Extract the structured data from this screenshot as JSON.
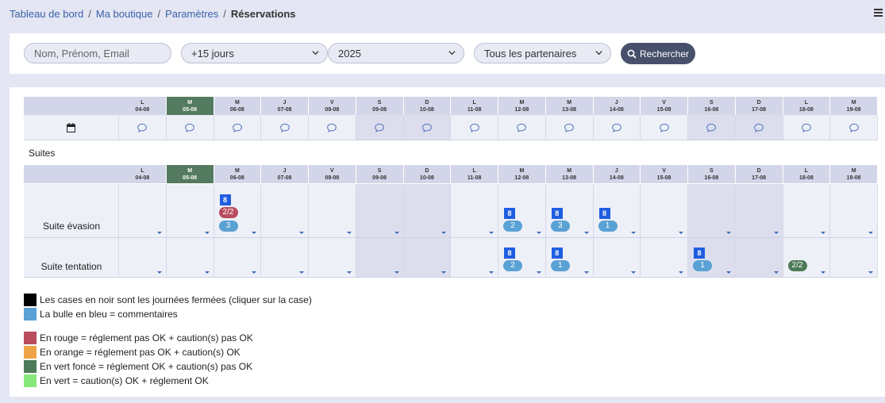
{
  "breadcrumb": {
    "items": [
      "Tableau de bord",
      "Ma boutique",
      "Paramètres"
    ],
    "separator": "/",
    "current": "Réservations"
  },
  "filters": {
    "search_placeholder": "Nom, Prénom, Email",
    "period": "+15 jours",
    "year": "2025",
    "partner": "Tous les partenaires",
    "search_button": "Rechercher"
  },
  "calendar": {
    "days": [
      {
        "letter": "L",
        "date": "04-08"
      },
      {
        "letter": "M",
        "date": "05-08"
      },
      {
        "letter": "M",
        "date": "06-08"
      },
      {
        "letter": "J",
        "date": "07-08"
      },
      {
        "letter": "V",
        "date": "08-08"
      },
      {
        "letter": "S",
        "date": "09-08"
      },
      {
        "letter": "D",
        "date": "10-08"
      },
      {
        "letter": "L",
        "date": "11-08"
      },
      {
        "letter": "M",
        "date": "12-08"
      },
      {
        "letter": "M",
        "date": "13-08"
      },
      {
        "letter": "J",
        "date": "14-08"
      },
      {
        "letter": "V",
        "date": "15-08"
      },
      {
        "letter": "S",
        "date": "16-08"
      },
      {
        "letter": "D",
        "date": "17-08"
      },
      {
        "letter": "L",
        "date": "18-08"
      },
      {
        "letter": "M",
        "date": "19-08"
      }
    ],
    "today_index": 1,
    "weekend_indices": [
      5,
      6,
      12,
      13
    ]
  },
  "section": "Suites",
  "rooms": [
    {
      "name": "Suite évasion",
      "entries": [
        {
          "day": 2,
          "badge": "8",
          "pills": [
            {
              "text": "2/2",
              "color": "#b94c5e"
            },
            {
              "text": "3",
              "color": "#5aa1d4"
            }
          ]
        },
        {
          "day": 8,
          "badge": "8",
          "pills": [
            {
              "text": "2",
              "color": "#5aa1d4"
            }
          ]
        },
        {
          "day": 9,
          "badge": "8",
          "pills": [
            {
              "text": "3",
              "color": "#5aa1d4"
            }
          ]
        },
        {
          "day": 10,
          "badge": "8",
          "pills": [
            {
              "text": "1",
              "color": "#5aa1d4"
            }
          ]
        }
      ]
    },
    {
      "name": "Suite tentation",
      "entries": [
        {
          "day": 8,
          "badge": "8",
          "pills": [
            {
              "text": "2",
              "color": "#5aa1d4"
            }
          ]
        },
        {
          "day": 9,
          "badge": "8",
          "pills": [
            {
              "text": "1",
              "color": "#5aa1d4"
            }
          ]
        },
        {
          "day": 12,
          "badge": "8",
          "pills": [
            {
              "text": "1",
              "color": "#5aa1d4"
            }
          ]
        },
        {
          "day": 14,
          "badge": "",
          "pills": [
            {
              "text": "2/2",
              "color": "#4d7a58"
            }
          ]
        }
      ]
    }
  ],
  "legend": [
    {
      "color": "#000000",
      "text": "Les cases en noir sont les journées fermées (cliquer sur la case)"
    },
    {
      "color": "#5aa1d4",
      "text": "La bulle en bleu = commentaires"
    },
    {
      "color": "#b94c5e",
      "text": "En rouge = réglement pas OK + caution(s) pas OK"
    },
    {
      "color": "#eea347",
      "text": "En orange = réglement pas OK + caution(s) OK"
    },
    {
      "color": "#4d7a58",
      "text": "En vert foncé = réglement OK + caution(s) pas OK"
    },
    {
      "color": "#86e87a",
      "text": "En vert = caution(s) OK + réglement OK"
    }
  ],
  "colors": {
    "header_bg": "#d3d6e8",
    "today": "#547a5f",
    "badge": "#1f5ee0",
    "cell": "#eef0f8",
    "weekend": "#dcdeee",
    "link": "#3a62a8"
  },
  "icons": {
    "calendar": "calendar-icon",
    "comment": "comment-bubble-icon",
    "search": "search-icon",
    "dropdown": "chevron-down-icon",
    "menu": "hamburger-menu-icon"
  }
}
